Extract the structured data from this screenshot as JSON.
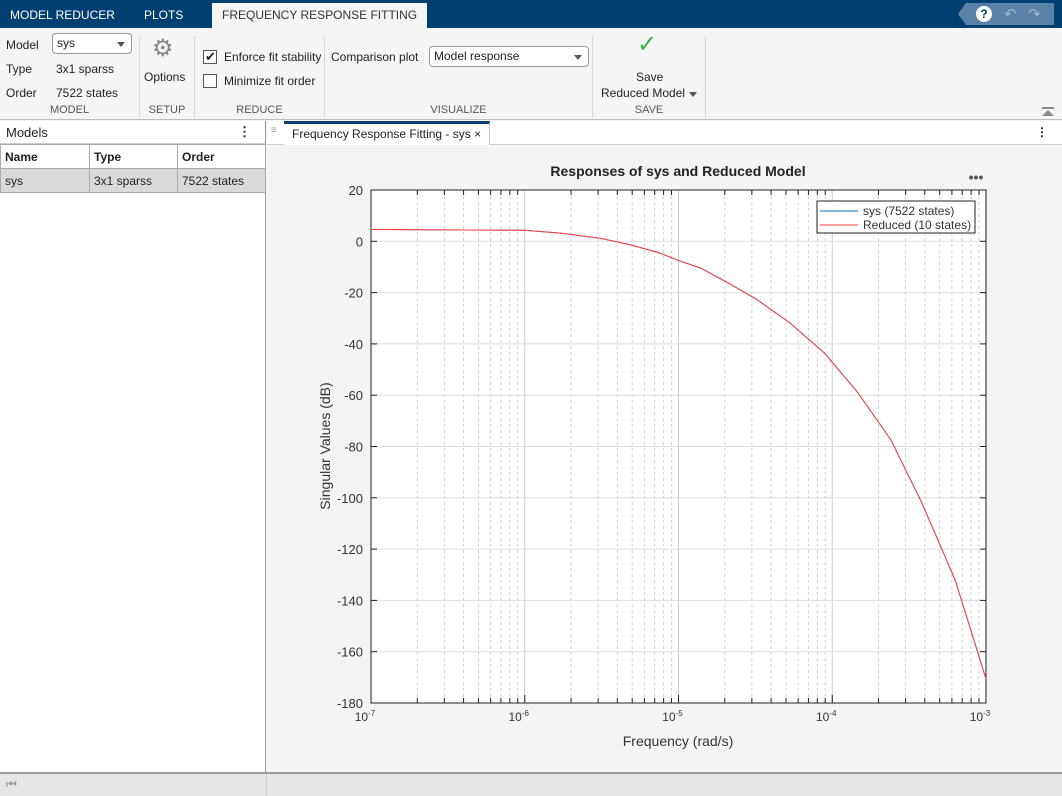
{
  "tabs": [
    {
      "label": "MODEL REDUCER"
    },
    {
      "label": "PLOTS"
    },
    {
      "label": "FREQUENCY RESPONSE FITTING",
      "active": true
    }
  ],
  "quick_access": {
    "help": "?",
    "undo": "undo-icon",
    "redo": "redo-icon"
  },
  "toolstrip": {
    "model": {
      "model_label": "Model",
      "model_value": "sys",
      "type_label": "Type",
      "type_value": "3x1 sparss",
      "order_label": "Order",
      "order_value": "7522 states",
      "section": "MODEL"
    },
    "setup": {
      "options_label": "Options",
      "section": "SETUP"
    },
    "reduce": {
      "enforce_label": "Enforce fit stability",
      "enforce_checked": true,
      "minimize_label": "Minimize fit order",
      "minimize_checked": false,
      "section": "REDUCE"
    },
    "visualize": {
      "comparison_label": "Comparison plot",
      "comparison_value": "Model response",
      "section": "VISUALIZE"
    },
    "save": {
      "line1": "Save",
      "line2": "Reduced Model",
      "section": "SAVE"
    }
  },
  "models_panel": {
    "title": "Models",
    "columns": [
      "Name",
      "Type",
      "Order"
    ],
    "rows": [
      [
        "sys",
        "3x1 sparss",
        "7522 states"
      ]
    ]
  },
  "document": {
    "tab_label": "Frequency Response Fitting - sys"
  },
  "chart_data": {
    "type": "line",
    "title": "Responses of sys and Reduced Model",
    "xlabel": "Frequency (rad/s)",
    "ylabel": "Singular Values (dB)",
    "xscale": "log",
    "xlim": [
      1e-07,
      0.001
    ],
    "ylim": [
      -180,
      20
    ],
    "xticks": [
      "10^-7",
      "10^-6",
      "10^-5",
      "10^-4",
      "10^-3"
    ],
    "yticks": [
      20,
      0,
      -20,
      -40,
      -60,
      -80,
      -100,
      -120,
      -140,
      -160,
      -180
    ],
    "grid": true,
    "legend_position": "top-right",
    "x": [
      1e-07,
      1e-06,
      1.7e-06,
      3.1e-06,
      4.9e-06,
      7.6e-06,
      1e-05,
      1.39e-05,
      2e-05,
      3.2e-05,
      5.3e-05,
      8.9e-05,
      0.000145,
      0.00024,
      0.00038,
      0.00063,
      0.001
    ],
    "series": [
      {
        "name": "sys (7522 states)",
        "color": "#0072bd",
        "values": [
          4.6,
          4.3,
          3.2,
          1.2,
          -1.4,
          -4.6,
          -7.5,
          -10.4,
          -15.5,
          -22.5,
          -31.8,
          -43.6,
          -58.6,
          -77.3,
          -101.6,
          -132,
          -170.6
        ]
      },
      {
        "name": "Reduced (10 states)",
        "color": "#ff4040",
        "values": [
          4.6,
          4.3,
          3.2,
          1.2,
          -1.4,
          -4.6,
          -7.5,
          -10.4,
          -15.5,
          -22.5,
          -31.8,
          -43.6,
          -58.6,
          -77.3,
          -101.6,
          -132,
          -170.6
        ]
      }
    ]
  }
}
